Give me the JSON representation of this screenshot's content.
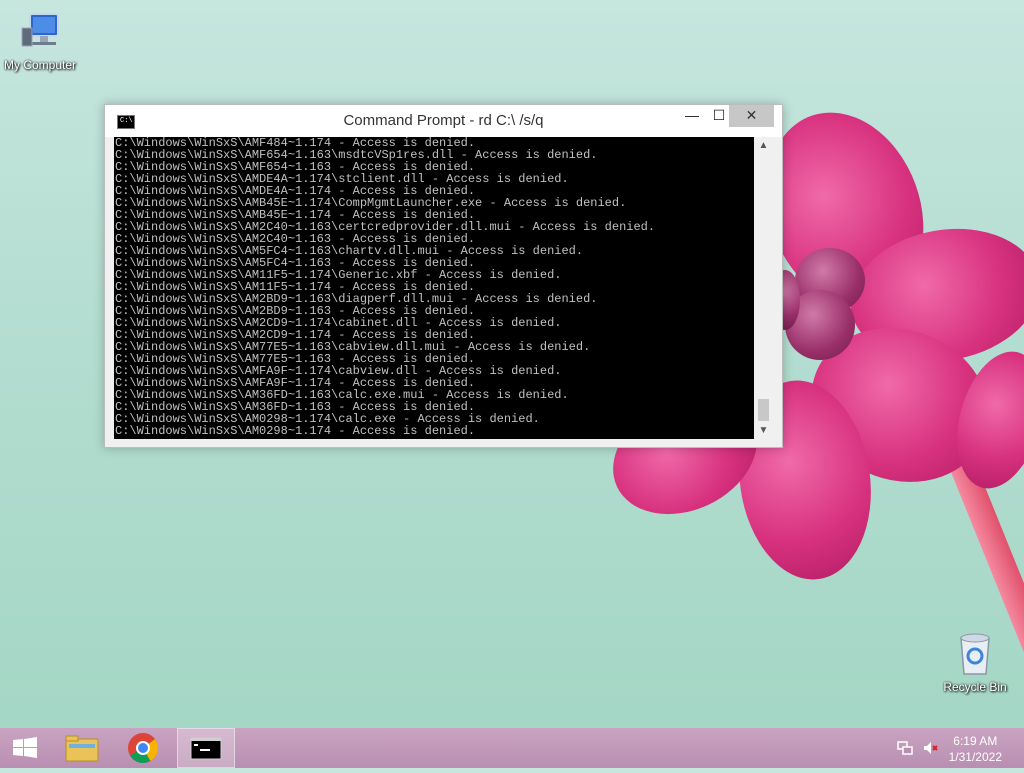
{
  "desktop": {
    "icons": [
      {
        "label": "My Computer",
        "icon": "computer-icon"
      },
      {
        "label": "Recycle Bin",
        "icon": "recycle-bin-icon"
      }
    ]
  },
  "window": {
    "title": "Command Prompt - rd  C:\\ /s/q",
    "icon_label": "C:\\",
    "buttons": {
      "minimize": "—",
      "maximize": "☐",
      "close": "✕"
    },
    "lines": [
      "C:\\Windows\\WinSxS\\AMF484~1.174 - Access is denied.",
      "C:\\Windows\\WinSxS\\AMF654~1.163\\msdtcVSp1res.dll - Access is denied.",
      "C:\\Windows\\WinSxS\\AMF654~1.163 - Access is denied.",
      "C:\\Windows\\WinSxS\\AMDE4A~1.174\\stclient.dll - Access is denied.",
      "C:\\Windows\\WinSxS\\AMDE4A~1.174 - Access is denied.",
      "C:\\Windows\\WinSxS\\AMB45E~1.174\\CompMgmtLauncher.exe - Access is denied.",
      "C:\\Windows\\WinSxS\\AMB45E~1.174 - Access is denied.",
      "C:\\Windows\\WinSxS\\AM2C40~1.163\\certcredprovider.dll.mui - Access is denied.",
      "C:\\Windows\\WinSxS\\AM2C40~1.163 - Access is denied.",
      "C:\\Windows\\WinSxS\\AM5FC4~1.163\\chartv.dll.mui - Access is denied.",
      "C:\\Windows\\WinSxS\\AM5FC4~1.163 - Access is denied.",
      "C:\\Windows\\WinSxS\\AM11F5~1.174\\Generic.xbf - Access is denied.",
      "C:\\Windows\\WinSxS\\AM11F5~1.174 - Access is denied.",
      "C:\\Windows\\WinSxS\\AM2BD9~1.163\\diagperf.dll.mui - Access is denied.",
      "C:\\Windows\\WinSxS\\AM2BD9~1.163 - Access is denied.",
      "C:\\Windows\\WinSxS\\AM2CD9~1.174\\cabinet.dll - Access is denied.",
      "C:\\Windows\\WinSxS\\AM2CD9~1.174 - Access is denied.",
      "C:\\Windows\\WinSxS\\AM77E5~1.163\\cabview.dll.mui - Access is denied.",
      "C:\\Windows\\WinSxS\\AM77E5~1.163 - Access is denied.",
      "C:\\Windows\\WinSxS\\AMFA9F~1.174\\cabview.dll - Access is denied.",
      "C:\\Windows\\WinSxS\\AMFA9F~1.174 - Access is denied.",
      "C:\\Windows\\WinSxS\\AM36FD~1.163\\calc.exe.mui - Access is denied.",
      "C:\\Windows\\WinSxS\\AM36FD~1.163 - Access is denied.",
      "C:\\Windows\\WinSxS\\AM0298~1.174\\calc.exe - Access is denied.",
      "C:\\Windows\\WinSxS\\AM0298~1.174 - Access is denied."
    ]
  },
  "taskbar": {
    "items": [
      {
        "name": "start-button",
        "icon": "windows-logo-icon"
      },
      {
        "name": "file-explorer",
        "icon": "folder-icon"
      },
      {
        "name": "chrome",
        "icon": "chrome-icon"
      },
      {
        "name": "command-prompt",
        "icon": "cmd-icon",
        "active": true
      }
    ],
    "tray": [
      {
        "icon": "network-icon"
      },
      {
        "icon": "volume-muted-icon"
      }
    ],
    "clock": {
      "time": "6:19 AM",
      "date": "1/31/2022"
    }
  },
  "colors": {
    "console_text": "#c0c0c0",
    "console_bg": "#000000",
    "taskbar": "#c09ab8"
  }
}
